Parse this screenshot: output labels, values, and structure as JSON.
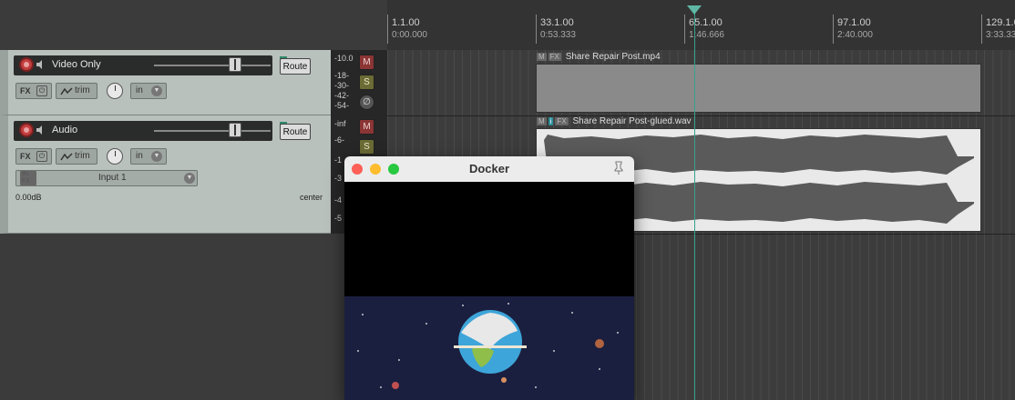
{
  "ruler": {
    "marks": [
      {
        "bar": "1.1.00",
        "time": "0:00.000"
      },
      {
        "bar": "33.1.00",
        "time": "0:53.333"
      },
      {
        "bar": "65.1.00",
        "time": "1:46.666"
      },
      {
        "bar": "97.1.00",
        "time": "2:40.000"
      },
      {
        "bar": "129.1.00",
        "time": "3:33.33"
      }
    ]
  },
  "tracks": [
    {
      "name": "Video Only",
      "route_label": "Route",
      "fx_label": "FX",
      "trim_label": "trim",
      "input_mode": "in",
      "meter_labels": [
        "-10.0",
        "-18-",
        "-30-",
        "-42-",
        "-54-"
      ]
    },
    {
      "name": "Audio",
      "route_label": "Route",
      "fx_label": "FX",
      "trim_label": "trim",
      "input_mode": "in",
      "input_tag": "IN FX",
      "input_name": "Input 1",
      "volume": "0.00dB",
      "pan": "center",
      "meter_labels": [
        "-inf",
        "-6-",
        "-1",
        "-3",
        "-4",
        "-5"
      ]
    }
  ],
  "meter_buttons": {
    "mute": "M",
    "solo": "S",
    "phase": "∅"
  },
  "items": [
    {
      "name": "Share Repair Post.mp4",
      "tags": [
        "M",
        "FX"
      ]
    },
    {
      "name": "Share Repair Post-glued.wav",
      "tags": [
        "M",
        "i",
        "FX"
      ]
    }
  ],
  "docker": {
    "title": "Docker"
  },
  "colors": {
    "playhead": "#3aa08c",
    "record": "#c23d3d",
    "traffic_close": "#fe5f57",
    "traffic_min": "#febc2e",
    "traffic_max": "#28c840"
  }
}
